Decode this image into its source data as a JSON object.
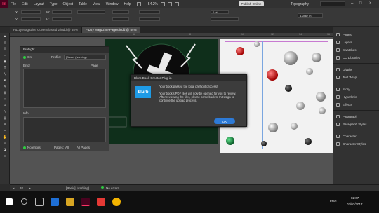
{
  "app": {
    "logo": "Id",
    "menu": [
      "File",
      "Edit",
      "Layout",
      "Type",
      "Object",
      "Table",
      "View",
      "Window",
      "Help"
    ],
    "zoom": "54.2%",
    "publish_button": "Publish Online",
    "workspace": "Typography"
  },
  "control_bar": {
    "x_label": "X:",
    "y_label": "Y:",
    "w_label": "W:",
    "h_label": "H:",
    "stroke_value": "0 pt",
    "width_value": "4.2867 in"
  },
  "tabs": [
    {
      "label": "Fuzzy Magazine Cover Blasted 2.indd @ 55%",
      "active": false
    },
    {
      "label": "Fuzzy Magazine Pages.indd @ 54%",
      "active": true
    }
  ],
  "ruler_numbers": [
    "6",
    "8",
    "10",
    "12",
    "14",
    "16"
  ],
  "preflight": {
    "title": "Preflight",
    "on_label": "On",
    "profile_label": "Profile:",
    "profile_value": "[Basic] (working)",
    "col_error": "Error",
    "col_page": "Page",
    "info_label": "Info",
    "no_errors": "No errors",
    "pages_label": "Pages:",
    "all_label": "All",
    "range_value": "All Pages"
  },
  "dialog": {
    "title": "Blurb Book Creator Plug-in",
    "logo_text": "blurb",
    "line1": "Your book passed the local preflight process!",
    "line2": "Your book's PDF files will now be opened for you to review. After reviewing the files, please come back to InDesign to continue the upload process.",
    "ok_label": "OK"
  },
  "right_panel": {
    "groups": [
      [
        "Pages",
        "Layers",
        "Swatches",
        "CC Libraries"
      ],
      [
        "Glyphs",
        "Text Wrap"
      ],
      [
        "Story",
        "Hyperlinks",
        "Effects"
      ],
      [
        "Paragraph",
        "Paragraph Styles"
      ],
      [
        "Character",
        "Character Styles"
      ]
    ]
  },
  "status_bar": {
    "page": "22",
    "style": "[Basic] (working)",
    "errors": "No errors"
  },
  "taskbar": {
    "lang": "ENG",
    "time": "02:07",
    "date": "03/03/2017"
  },
  "colors": {
    "accent": "#2d7ad6",
    "blurb": "#1e9be6",
    "indesign": "#ff3366"
  }
}
